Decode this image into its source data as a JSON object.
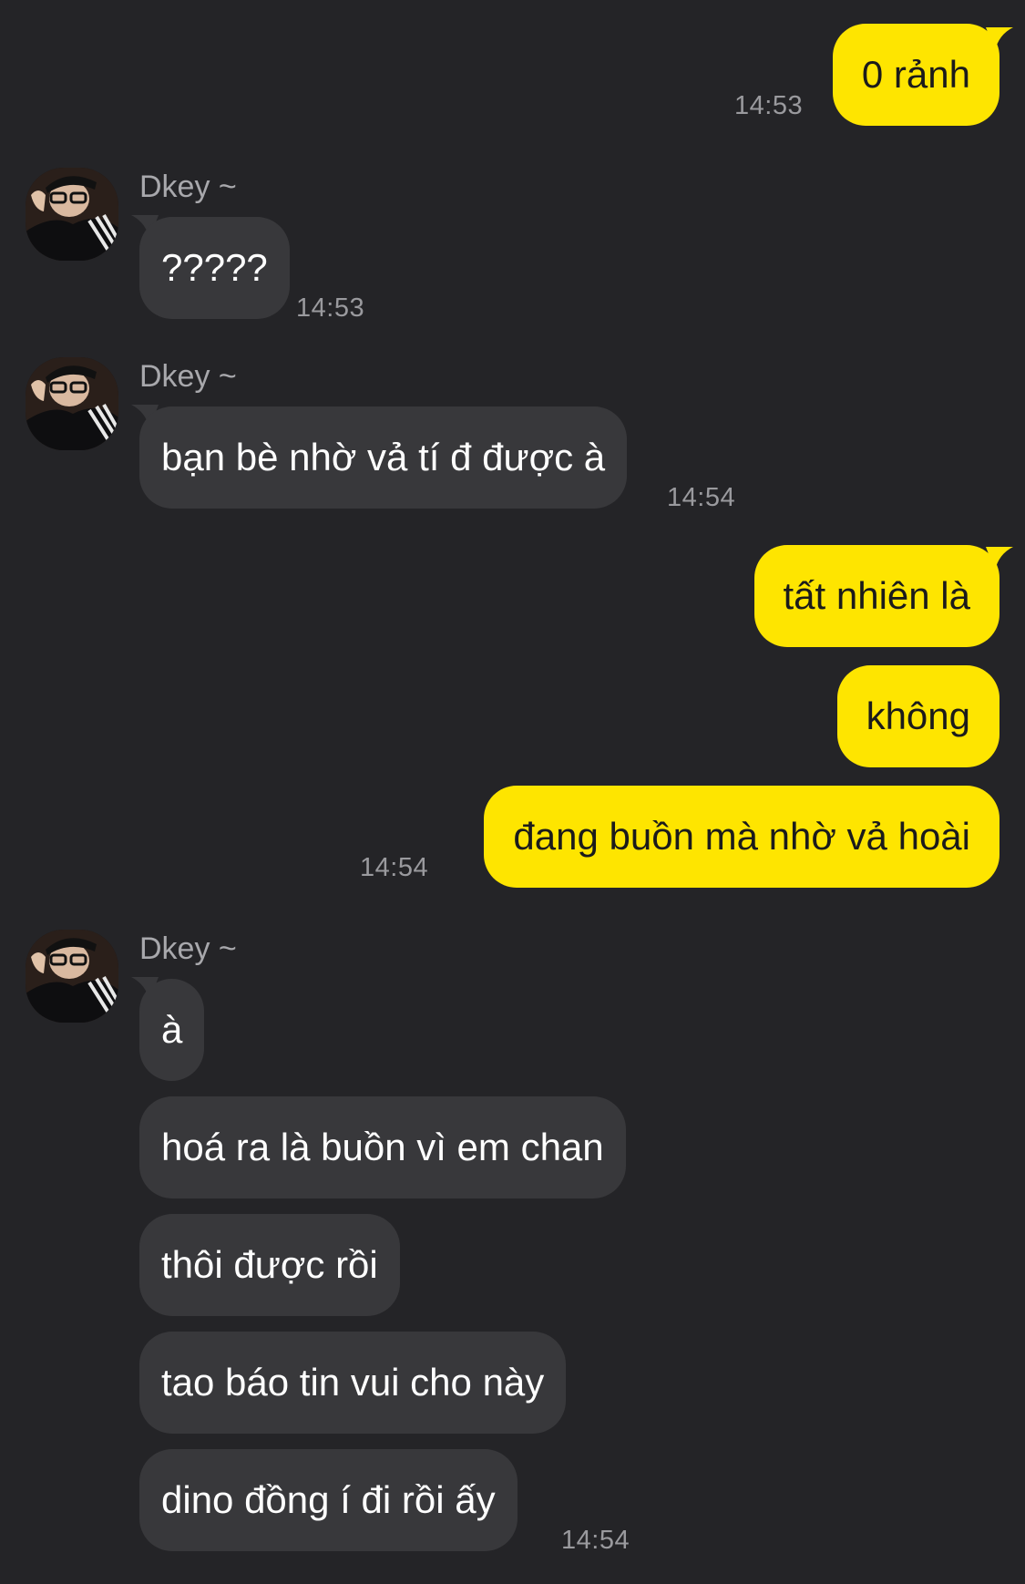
{
  "colors": {
    "background": "#242427",
    "outgoing_bubble": "#fee500",
    "incoming_bubble": "#38383b",
    "timestamp": "#9a9a9e",
    "sender_name": "#a8a8ac"
  },
  "messages": {
    "m1": {
      "text": "0 rảnh",
      "time": "14:53"
    },
    "m2": {
      "sender": "Dkey ~",
      "text": "?????",
      "time": "14:53"
    },
    "m3": {
      "sender": "Dkey ~",
      "text": "bạn bè nhờ vả tí đ được à",
      "time": "14:54"
    },
    "m4": {
      "text": "tất nhiên là"
    },
    "m5": {
      "text": "không"
    },
    "m6": {
      "text": "đang buồn mà nhờ vả hoài",
      "time": "14:54"
    },
    "m7": {
      "sender": "Dkey ~",
      "text": "à"
    },
    "m8": {
      "text": "hoá ra là buồn vì em chan"
    },
    "m9": {
      "text": "thôi được rồi"
    },
    "m10": {
      "text": "tao báo tin vui cho này"
    },
    "m11": {
      "text": "dino đồng í đi rồi ấy",
      "time": "14:54"
    }
  },
  "avatar_icon": "user-photo-avatar"
}
